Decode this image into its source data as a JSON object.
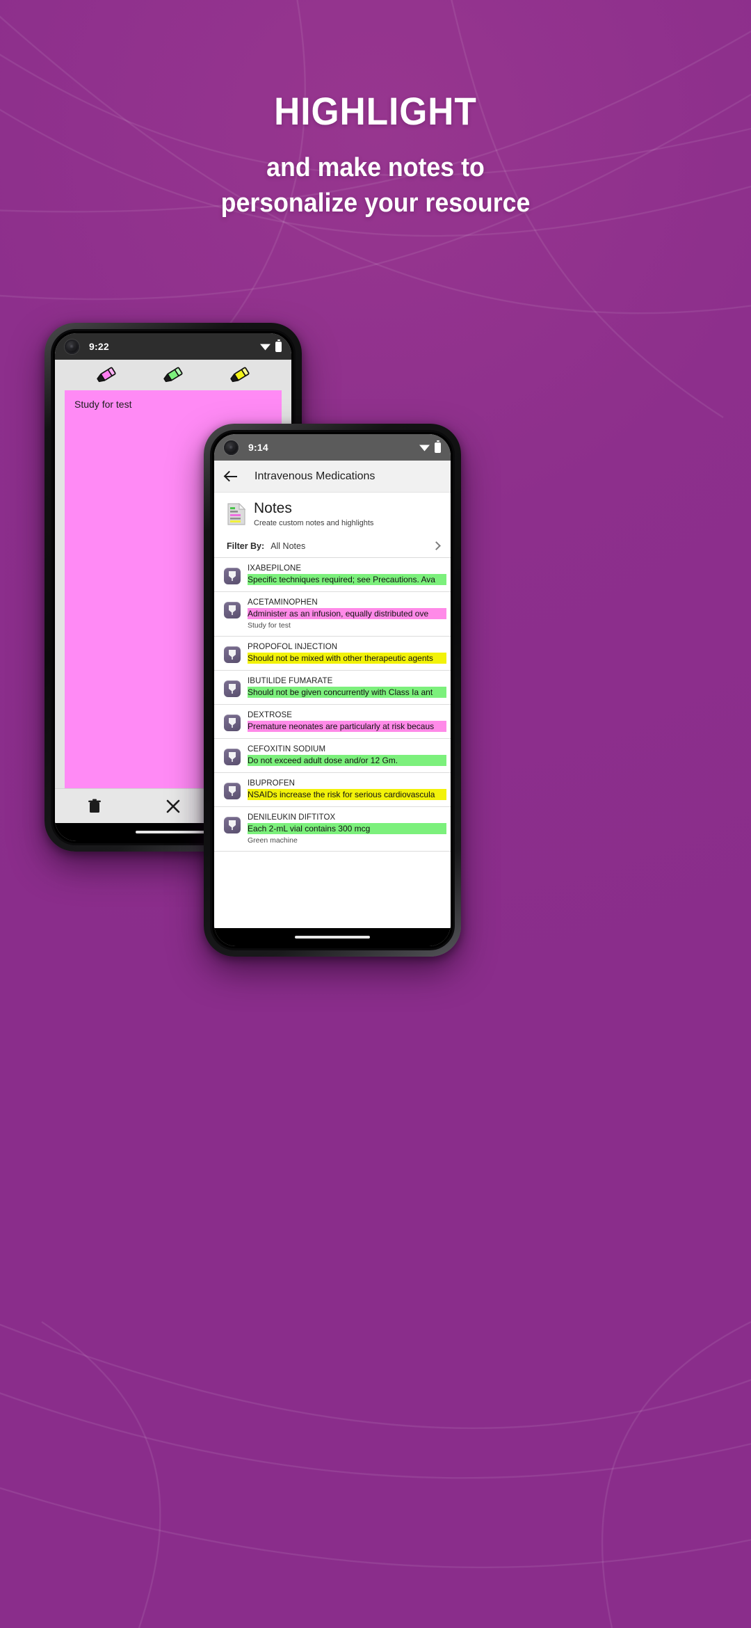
{
  "background": {
    "color": "#8b2f8f"
  },
  "promo": {
    "headline": "HIGHLIGHT",
    "subtitle_line1": "and make notes to",
    "subtitle_line2": "personalize your resource"
  },
  "back_phone": {
    "status": {
      "time": "9:22"
    },
    "highlighter_toolbar": {
      "pens": [
        {
          "name": "pink-highlighter-pen",
          "color": "#ff7df0"
        },
        {
          "name": "green-highlighter-pen",
          "color": "#7cf07c"
        },
        {
          "name": "yellow-highlighter-pen",
          "color": "#f4f416"
        }
      ]
    },
    "note": {
      "text": "Study for test",
      "paper_color": "#ff8af5"
    },
    "bottom_bar": {
      "delete_label": "delete-icon",
      "close_label": "close-icon"
    }
  },
  "front_phone": {
    "status": {
      "time": "9:14"
    },
    "appbar": {
      "back_label": "back-arrow-icon",
      "title": "Intravenous Medications"
    },
    "notes_header": {
      "title": "Notes",
      "subtitle": "Create custom notes and highlights"
    },
    "filter": {
      "label": "Filter By:",
      "value": "All Notes",
      "chevron": "chevron-right-icon"
    },
    "notes": [
      {
        "drug": "IXABEPILONE",
        "highlight": "Specific techniques required; see Precautions. Ava",
        "highlight_color": "green",
        "user_note": null
      },
      {
        "drug": "ACETAMINOPHEN",
        "highlight": "Administer as an infusion, equally distributed ove",
        "highlight_color": "pink",
        "user_note": "Study for test"
      },
      {
        "drug": "PROPOFOL INJECTION",
        "highlight": "Should not be mixed with other therapeutic agents",
        "highlight_color": "yellow",
        "user_note": null
      },
      {
        "drug": "IBUTILIDE FUMARATE",
        "highlight": "Should not be given concurrently with Class Ia ant",
        "highlight_color": "green",
        "user_note": null
      },
      {
        "drug": "DEXTROSE",
        "highlight": "Premature neonates are particularly at risk becaus",
        "highlight_color": "pink",
        "user_note": null
      },
      {
        "drug": "CEFOXITIN SODIUM",
        "highlight": "Do not exceed adult dose and/or 12 Gm.",
        "highlight_color": "green",
        "user_note": null
      },
      {
        "drug": "IBUPROFEN",
        "highlight": "NSAIDs increase the risk for serious cardiovascula",
        "highlight_color": "yellow",
        "user_note": null
      },
      {
        "drug": "DENILEUKIN DIFTITOX",
        "highlight": "Each 2-mL vial contains 300 mcg",
        "highlight_color": "green",
        "user_note": "Green machine"
      }
    ]
  },
  "colors": {
    "highlight_green": "#7cf07c",
    "highlight_pink": "#ff8ae8",
    "highlight_yellow": "#f2f20a",
    "brand_purple": "#8b2f8f",
    "icon_purple": "#6a5f80"
  }
}
